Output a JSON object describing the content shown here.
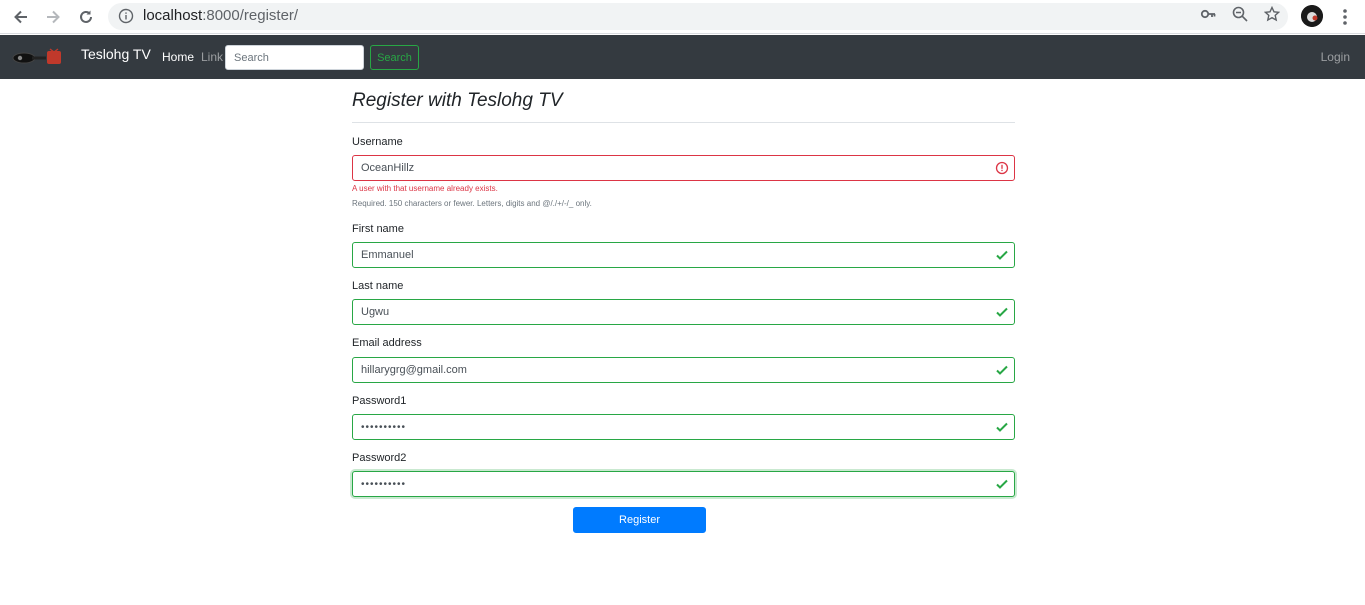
{
  "browser": {
    "url_host": "localhost",
    "url_rest": ":8000/register/"
  },
  "navbar": {
    "brand": "Teslohg TV",
    "home_label": "Home",
    "link_label": "Link",
    "search_placeholder": "Search",
    "search_button": "Search",
    "login_label": "Login"
  },
  "form": {
    "title": "Register with Teslohg TV",
    "username": {
      "label": "Username",
      "value": "OceanHillz",
      "error": "A user with that username already exists.",
      "help": "Required. 150 characters or fewer. Letters, digits and @/./+/-/_ only."
    },
    "first_name": {
      "label": "First name",
      "value": "Emmanuel"
    },
    "last_name": {
      "label": "Last name",
      "value": "Ugwu"
    },
    "email": {
      "label": "Email address",
      "value": "hillarygrg@gmail.com"
    },
    "password1": {
      "label": "Password1",
      "value": "••••••••••"
    },
    "password2": {
      "label": "Password2",
      "value": "••••••••••"
    },
    "submit_label": "Register"
  },
  "colors": {
    "navbar_bg": "#343a40",
    "valid": "#28a745",
    "invalid": "#dc3545",
    "primary": "#007bff"
  }
}
